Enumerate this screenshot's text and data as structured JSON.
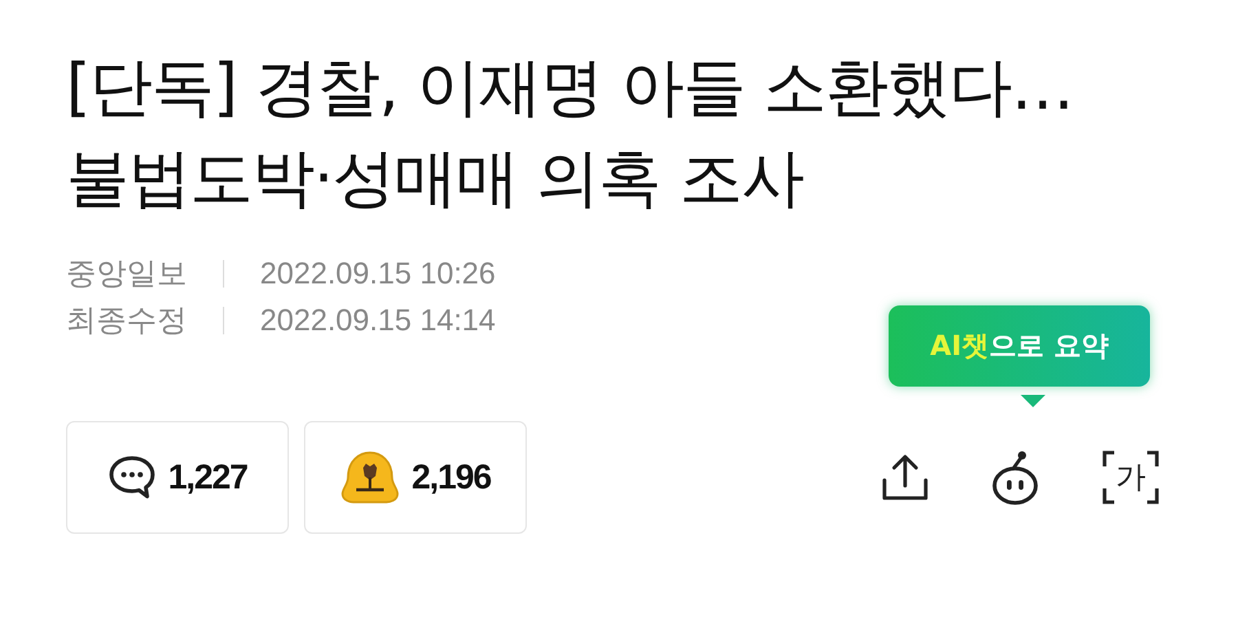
{
  "headline": "[단독] 경찰, 이재명 아들 소환했다…불법도박·성매매 의혹 조사",
  "meta": [
    {
      "label": "중앙일보",
      "value": "2022.09.15 10:26"
    },
    {
      "label": "최종수정",
      "value": "2022.09.15 14:14"
    }
  ],
  "reactions": [
    {
      "kind": "comment",
      "count": "1,227"
    },
    {
      "kind": "like",
      "count": "2,196"
    }
  ],
  "tooltip": {
    "highlight": "AI챗",
    "text": "으로 요약"
  },
  "tools": [
    {
      "kind": "share"
    },
    {
      "kind": "bot"
    },
    {
      "kind": "font",
      "glyph": "가"
    }
  ]
}
